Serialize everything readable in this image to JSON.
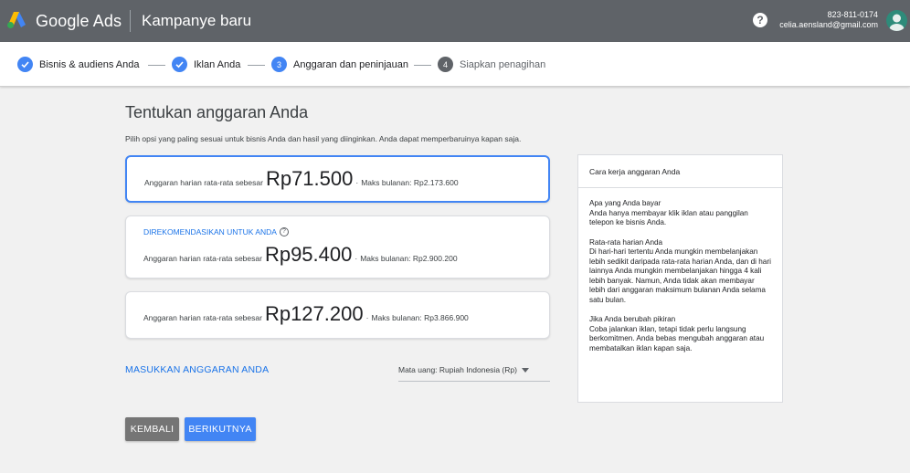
{
  "header": {
    "brand": "Google Ads",
    "title": "Kampanye baru",
    "help_icon": "help-icon",
    "account_phone": "823-811-0174",
    "account_email": "celia.aensland@gmail.com"
  },
  "stepper": {
    "steps": [
      {
        "label": "Bisnis & audiens Anda",
        "state": "done"
      },
      {
        "label": "Iklan Anda",
        "state": "done"
      },
      {
        "label": "Anggaran dan peninjauan",
        "state": "current",
        "number": "3"
      },
      {
        "label": "Siapkan penagihan",
        "state": "todo",
        "number": "4"
      }
    ]
  },
  "main": {
    "title": "Tentukan anggaran Anda",
    "description": "Pilih opsi yang paling sesuai untuk bisnis Anda dan hasil yang diinginkan. Anda dapat memperbaruinya kapan saja.",
    "options": [
      {
        "prefix": "Anggaran harian rata-rata sebesar",
        "amount": "Rp71.500",
        "max": "Maks bulanan: Rp2.173.600",
        "selected": true
      },
      {
        "recommended": "DIREKOMENDASIKAN UNTUK ANDA",
        "prefix": "Anggaran harian rata-rata sebesar",
        "amount": "Rp95.400",
        "max": "Maks bulanan: Rp2.900.200"
      },
      {
        "prefix": "Anggaran harian rata-rata sebesar",
        "amount": "Rp127.200",
        "max": "Maks bulanan: Rp3.866.900"
      }
    ],
    "dot": "·",
    "enter_budget": "MASUKKAN ANGGARAN ANDA",
    "currency_label": "Mata uang: Rupiah Indonesia (Rp)",
    "back_button": "KEMBALI",
    "next_button": "BERIKUTNYA"
  },
  "side": {
    "title": "Cara kerja anggaran Anda",
    "sections": [
      {
        "heading": "Apa yang Anda bayar",
        "body": "Anda hanya membayar klik iklan atau panggilan telepon ke bisnis Anda."
      },
      {
        "heading": "Rata-rata harian Anda",
        "body": "Di hari-hari tertentu Anda mungkin membelanjakan lebih sedikit daripada rata-rata harian Anda, dan di hari lainnya Anda mungkin membelanjakan hingga 4 kali lebih banyak. Namun, Anda tidak akan membayar lebih dari anggaran maksimum bulanan Anda selama satu bulan."
      },
      {
        "heading": "Jika Anda berubah pikiran",
        "body": "Coba jalankan iklan, tetapi tidak perlu langsung berkomitmen. Anda bebas mengubah anggaran atau membatalkan iklan kapan saja."
      }
    ]
  },
  "colors": {
    "accent": "#4285f4",
    "header_bg": "#5f6368",
    "link": "#1a73e8"
  }
}
